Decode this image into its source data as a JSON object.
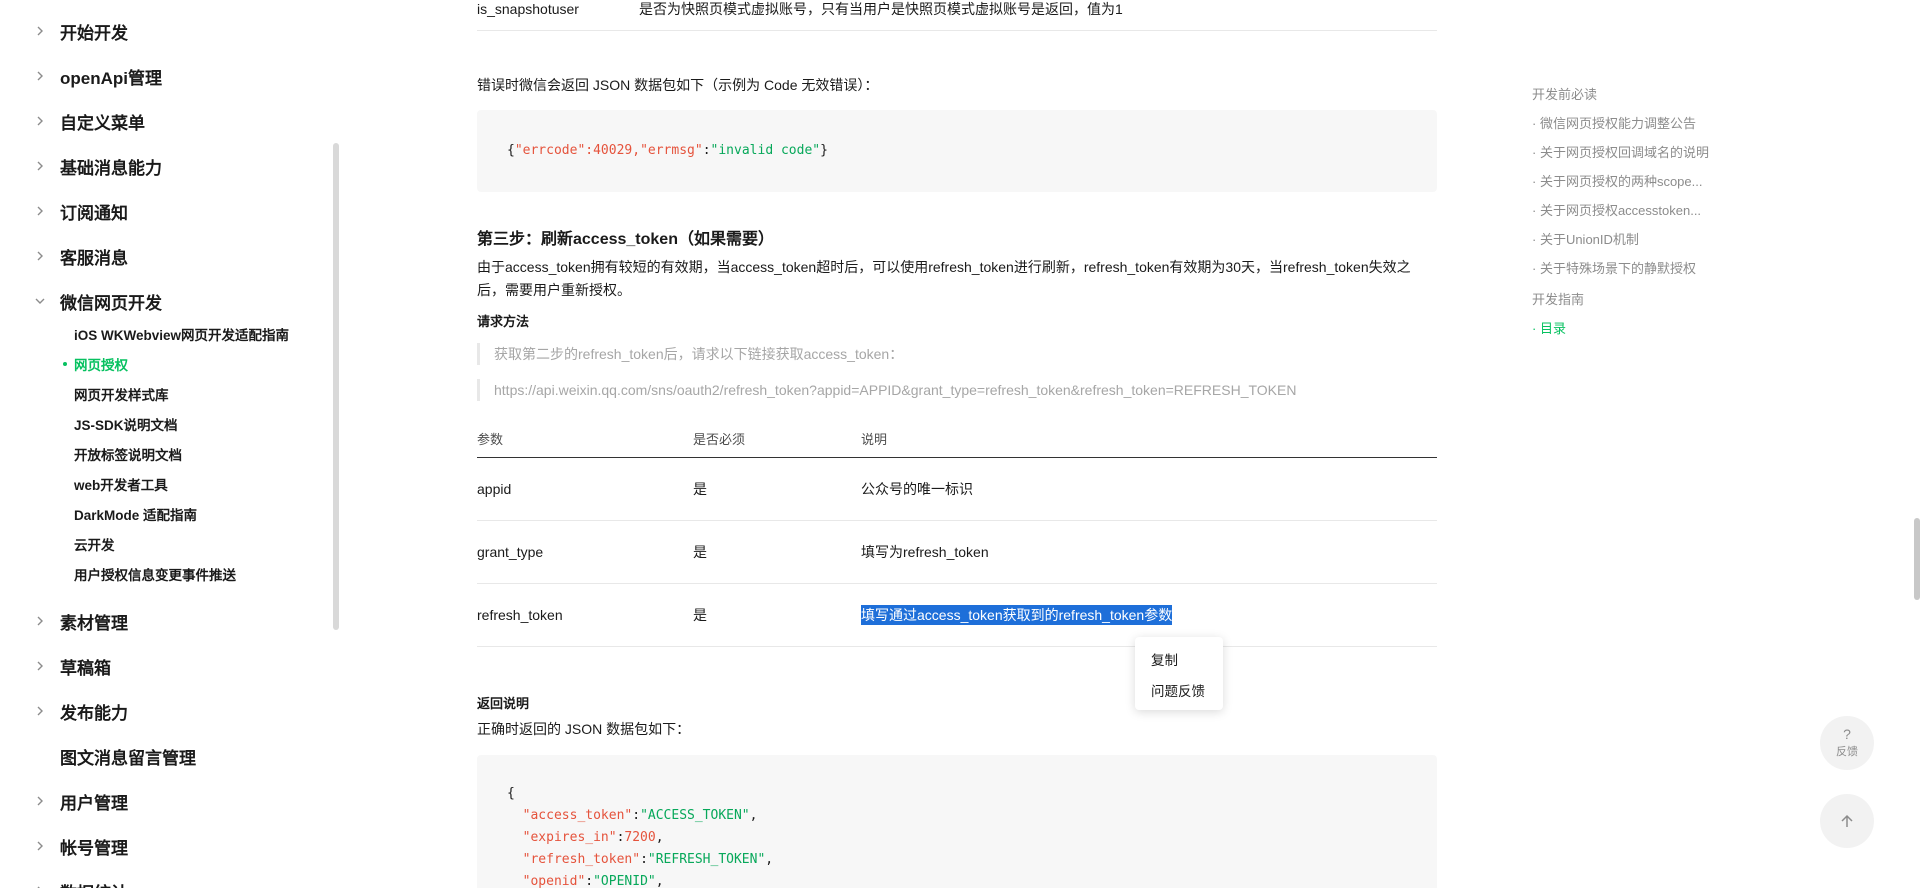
{
  "sidebar": {
    "items": [
      {
        "label": "开始开发",
        "expanded": false
      },
      {
        "label": "openApi管理",
        "expanded": false
      },
      {
        "label": "自定义菜单",
        "expanded": false
      },
      {
        "label": "基础消息能力",
        "expanded": false
      },
      {
        "label": "订阅通知",
        "expanded": false
      },
      {
        "label": "客服消息",
        "expanded": false
      },
      {
        "label": "微信网页开发",
        "expanded": true
      },
      {
        "label": "素材管理",
        "expanded": false
      },
      {
        "label": "草稿箱",
        "expanded": false
      },
      {
        "label": "发布能力",
        "expanded": false
      },
      {
        "label": "图文消息留言管理"
      },
      {
        "label": "用户管理",
        "expanded": false
      },
      {
        "label": "帐号管理",
        "expanded": false
      },
      {
        "label": "数据统计",
        "expanded": false
      }
    ],
    "subitems": [
      {
        "label": "iOS WKWebview网页开发适配指南"
      },
      {
        "label": "网页授权",
        "active": true
      },
      {
        "label": "网页开发样式库"
      },
      {
        "label": "JS-SDK说明文档"
      },
      {
        "label": "开放标签说明文档"
      },
      {
        "label": "web开发者工具"
      },
      {
        "label": "DarkMode 适配指南"
      },
      {
        "label": "云开发"
      },
      {
        "label": "用户授权信息变更事件推送"
      }
    ]
  },
  "content": {
    "top_partial": {
      "param": "is_snapshotuser",
      "desc": "是否为快照页模式虚拟账号，只有当用户是快照页模式虚拟账号是返回，值为1"
    },
    "error_intro": "错误时微信会返回 JSON 数据包如下（示例为 Code 无效错误）：",
    "error_code": {
      "open": "{",
      "k1": "\"errcode\"",
      "v1": ":40029,",
      "k2": "\"errmsg\"",
      "colon": ":",
      "v2": "\"invalid code\"",
      "close": "}"
    },
    "step3_title": "第三步：刷新access_token（如果需要）",
    "step3_desc_line1": "由于access_token拥有较短的有效期，当access_token超时后，可以使用refresh_token进行刷新，refresh_token有效期为30天，当refresh_token失效之",
    "step3_desc_line2": "后，需要用户重新授权。",
    "request_method_label": "请求方法",
    "quote1": "获取第二步的refresh_token后，请求以下链接获取access_token：",
    "quote2": "https://api.weixin.qq.com/sns/oauth2/refresh_token?appid=APPID&grant_type=refresh_token&refresh_token=REFRESH_TOKEN",
    "table": {
      "headers": [
        "参数",
        "是否必须",
        "说明"
      ],
      "rows": [
        {
          "param": "appid",
          "required": "是",
          "desc": "公众号的唯一标识"
        },
        {
          "param": "grant_type",
          "required": "是",
          "desc": "填写为refresh_token"
        },
        {
          "param": "refresh_token",
          "required": "是",
          "desc": "填写通过access_token获取到的refresh_token参数"
        }
      ]
    },
    "return_label": "返回说明",
    "return_intro": "正确时返回的 JSON 数据包如下：",
    "return_code": [
      {
        "key": "{",
        "val": ""
      },
      {
        "key": "\"access_token\"",
        "val": "\"ACCESS_TOKEN\"",
        "sep": ":",
        "end": ","
      },
      {
        "key": "\"expires_in\"",
        "val": "7200",
        "sep": ":",
        "end": ","
      },
      {
        "key": "\"refresh_token\"",
        "val": "\"REFRESH_TOKEN\"",
        "sep": ":",
        "end": ","
      },
      {
        "key": "\"openid\"",
        "val": "\"OPENID\"",
        "sep": ":",
        "end": ","
      }
    ]
  },
  "context_menu": {
    "copy": "复制",
    "feedback": "问题反馈"
  },
  "toc": [
    {
      "label": "开发前必读",
      "level": 0
    },
    {
      "label": "· 微信网页授权能力调整公告",
      "level": 1
    },
    {
      "label": "· 关于网页授权回调域名的说明",
      "level": 1
    },
    {
      "label": "· 关于网页授权的两种scope...",
      "level": 1
    },
    {
      "label": "· 关于网页授权accesstoken...",
      "level": 1
    },
    {
      "label": "· 关于UnionID机制",
      "level": 1
    },
    {
      "label": "· 关于特殊场景下的静默授权",
      "level": 1
    },
    {
      "label": "开发指南",
      "level": 0
    },
    {
      "label": "· 目录",
      "level": 1,
      "active": true
    }
  ],
  "floating": {
    "feedback_q": "?",
    "feedback_label": "反馈"
  },
  "colors": {
    "accent": "#07c160",
    "selection": "#1e6fd9",
    "code_key": "#e5533c",
    "code_string": "#07a85a"
  }
}
